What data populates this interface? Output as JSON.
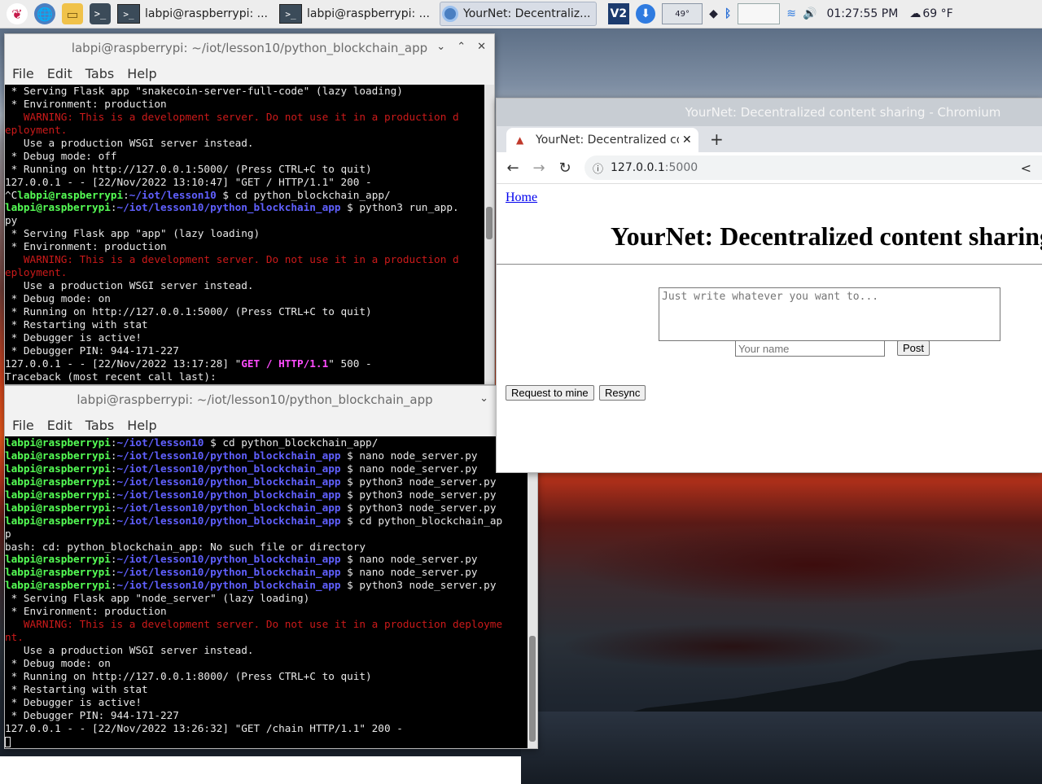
{
  "taskbar": {
    "tasks": [
      {
        "label": "labpi@raspberrypi: ...",
        "active": false
      },
      {
        "label": "labpi@raspberrypi: ...",
        "active": false
      },
      {
        "label": "YourNet: Decentraliz...",
        "active": true
      }
    ],
    "cpu_temp": "49°",
    "clock": "01:27:55 PM",
    "weather": "69 °F"
  },
  "terminal_top": {
    "title": "labpi@raspberrypi: ~/iot/lesson10/python_blockchain_app",
    "menu": [
      "File",
      "Edit",
      "Tabs",
      "Help"
    ],
    "lines": [
      [
        {
          "t": " * Serving Flask app \"snakecoin-server-full-code\" (lazy loading)",
          "c": "white"
        }
      ],
      [
        {
          "t": " * Environment: production",
          "c": "white"
        }
      ],
      [
        {
          "t": "   WARNING: This is a development server. Do not use it in a production d",
          "c": "red"
        }
      ],
      [
        {
          "t": "eployment.",
          "c": "red"
        }
      ],
      [
        {
          "t": "   Use a production WSGI server instead.",
          "c": "white"
        }
      ],
      [
        {
          "t": " * Debug mode: off",
          "c": "white"
        }
      ],
      [
        {
          "t": " * Running on http://127.0.0.1:5000/ (Press CTRL+C to quit)",
          "c": "white"
        }
      ],
      [
        {
          "t": "127.0.0.1 - - [22/Nov/2022 13:10:47] \"GET / HTTP/1.1\" 200 -",
          "c": "white"
        }
      ],
      [
        {
          "t": "^C",
          "c": "white"
        },
        {
          "t": "labpi@raspberrypi",
          "c": "green"
        },
        {
          "t": ":",
          "c": "white"
        },
        {
          "t": "~/iot/lesson10",
          "c": "blue"
        },
        {
          "t": " $ cd python_blockchain_app/",
          "c": "white"
        }
      ],
      [
        {
          "t": "labpi@raspberrypi",
          "c": "green"
        },
        {
          "t": ":",
          "c": "white"
        },
        {
          "t": "~/iot/lesson10/python_blockchain_app",
          "c": "blue"
        },
        {
          "t": " $ python3 run_app.",
          "c": "white"
        }
      ],
      [
        {
          "t": "py",
          "c": "white"
        }
      ],
      [
        {
          "t": " * Serving Flask app \"app\" (lazy loading)",
          "c": "white"
        }
      ],
      [
        {
          "t": " * Environment: production",
          "c": "white"
        }
      ],
      [
        {
          "t": "   WARNING: This is a development server. Do not use it in a production d",
          "c": "red"
        }
      ],
      [
        {
          "t": "eployment.",
          "c": "red"
        }
      ],
      [
        {
          "t": "   Use a production WSGI server instead.",
          "c": "white"
        }
      ],
      [
        {
          "t": " * Debug mode: on",
          "c": "white"
        }
      ],
      [
        {
          "t": " * Running on http://127.0.0.1:5000/ (Press CTRL+C to quit)",
          "c": "white"
        }
      ],
      [
        {
          "t": " * Restarting with stat",
          "c": "white"
        }
      ],
      [
        {
          "t": " * Debugger is active!",
          "c": "white"
        }
      ],
      [
        {
          "t": " * Debugger PIN: 944-171-227",
          "c": "white"
        }
      ],
      [
        {
          "t": "127.0.0.1 - - [22/Nov/2022 13:17:28] \"",
          "c": "white"
        },
        {
          "t": "GET / HTTP/1.1",
          "c": "mag"
        },
        {
          "t": "\" 500 -",
          "c": "white"
        }
      ],
      [
        {
          "t": "Traceback (most recent call last):",
          "c": "white"
        }
      ]
    ]
  },
  "terminal_bottom": {
    "title": "labpi@raspberrypi: ~/iot/lesson10/python_blockchain_app",
    "menu": [
      "File",
      "Edit",
      "Tabs",
      "Help"
    ],
    "lines": [
      [
        {
          "t": "labpi@raspberrypi",
          "c": "green"
        },
        {
          "t": ":",
          "c": "white"
        },
        {
          "t": "~/iot/lesson10",
          "c": "blue"
        },
        {
          "t": " $ cd python_blockchain_app/",
          "c": "white"
        }
      ],
      [
        {
          "t": "labpi@raspberrypi",
          "c": "green"
        },
        {
          "t": ":",
          "c": "white"
        },
        {
          "t": "~/iot/lesson10/python_blockchain_app",
          "c": "blue"
        },
        {
          "t": " $ nano node_server.py",
          "c": "white"
        }
      ],
      [
        {
          "t": "labpi@raspberrypi",
          "c": "green"
        },
        {
          "t": ":",
          "c": "white"
        },
        {
          "t": "~/iot/lesson10/python_blockchain_app",
          "c": "blue"
        },
        {
          "t": " $ nano node_server.py",
          "c": "white"
        }
      ],
      [
        {
          "t": "labpi@raspberrypi",
          "c": "green"
        },
        {
          "t": ":",
          "c": "white"
        },
        {
          "t": "~/iot/lesson10/python_blockchain_app",
          "c": "blue"
        },
        {
          "t": " $ python3 node_server.py",
          "c": "white"
        }
      ],
      [
        {
          "t": "labpi@raspberrypi",
          "c": "green"
        },
        {
          "t": ":",
          "c": "white"
        },
        {
          "t": "~/iot/lesson10/python_blockchain_app",
          "c": "blue"
        },
        {
          "t": " $ python3 node_server.py",
          "c": "white"
        }
      ],
      [
        {
          "t": "labpi@raspberrypi",
          "c": "green"
        },
        {
          "t": ":",
          "c": "white"
        },
        {
          "t": "~/iot/lesson10/python_blockchain_app",
          "c": "blue"
        },
        {
          "t": " $ python3 node_server.py",
          "c": "white"
        }
      ],
      [
        {
          "t": "labpi@raspberrypi",
          "c": "green"
        },
        {
          "t": ":",
          "c": "white"
        },
        {
          "t": "~/iot/lesson10/python_blockchain_app",
          "c": "blue"
        },
        {
          "t": " $ cd python_blockchain_ap",
          "c": "white"
        }
      ],
      [
        {
          "t": "p",
          "c": "white"
        }
      ],
      [
        {
          "t": "bash: cd: python_blockchain_app: No such file or directory",
          "c": "white"
        }
      ],
      [
        {
          "t": "labpi@raspberrypi",
          "c": "green"
        },
        {
          "t": ":",
          "c": "white"
        },
        {
          "t": "~/iot/lesson10/python_blockchain_app",
          "c": "blue"
        },
        {
          "t": " $ nano node_server.py",
          "c": "white"
        }
      ],
      [
        {
          "t": "labpi@raspberrypi",
          "c": "green"
        },
        {
          "t": ":",
          "c": "white"
        },
        {
          "t": "~/iot/lesson10/python_blockchain_app",
          "c": "blue"
        },
        {
          "t": " $ nano node_server.py",
          "c": "white"
        }
      ],
      [
        {
          "t": "labpi@raspberrypi",
          "c": "green"
        },
        {
          "t": ":",
          "c": "white"
        },
        {
          "t": "~/iot/lesson10/python_blockchain_app",
          "c": "blue"
        },
        {
          "t": " $ python3 node_server.py",
          "c": "white"
        }
      ],
      [
        {
          "t": " * Serving Flask app \"node_server\" (lazy loading)",
          "c": "white"
        }
      ],
      [
        {
          "t": " * Environment: production",
          "c": "white"
        }
      ],
      [
        {
          "t": "   WARNING: This is a development server. Do not use it in a production deployme",
          "c": "red"
        }
      ],
      [
        {
          "t": "nt.",
          "c": "red"
        }
      ],
      [
        {
          "t": "   Use a production WSGI server instead.",
          "c": "white"
        }
      ],
      [
        {
          "t": " * Debug mode: on",
          "c": "white"
        }
      ],
      [
        {
          "t": " * Running on http://127.0.0.1:8000/ (Press CTRL+C to quit)",
          "c": "white"
        }
      ],
      [
        {
          "t": " * Restarting with stat",
          "c": "white"
        }
      ],
      [
        {
          "t": " * Debugger is active!",
          "c": "white"
        }
      ],
      [
        {
          "t": " * Debugger PIN: 944-171-227",
          "c": "white"
        }
      ],
      [
        {
          "t": "127.0.0.1 - - [22/Nov/2022 13:26:32] \"GET /chain HTTP/1.1\" 200 -",
          "c": "white"
        }
      ]
    ]
  },
  "browser": {
    "window_title": "YourNet: Decentralized content sharing - Chromium",
    "tab_title": "YourNet: Decentralized co",
    "url_host": "127.0.0.1",
    "url_port": ":5000",
    "page": {
      "home_link": "Home",
      "heading": "YourNet: Decentralized content sharing",
      "textarea_placeholder": "Just write whatever you want to...",
      "name_placeholder": "Your name",
      "post_button": "Post",
      "mine_button": "Request to mine",
      "resync_button": "Resync"
    }
  }
}
